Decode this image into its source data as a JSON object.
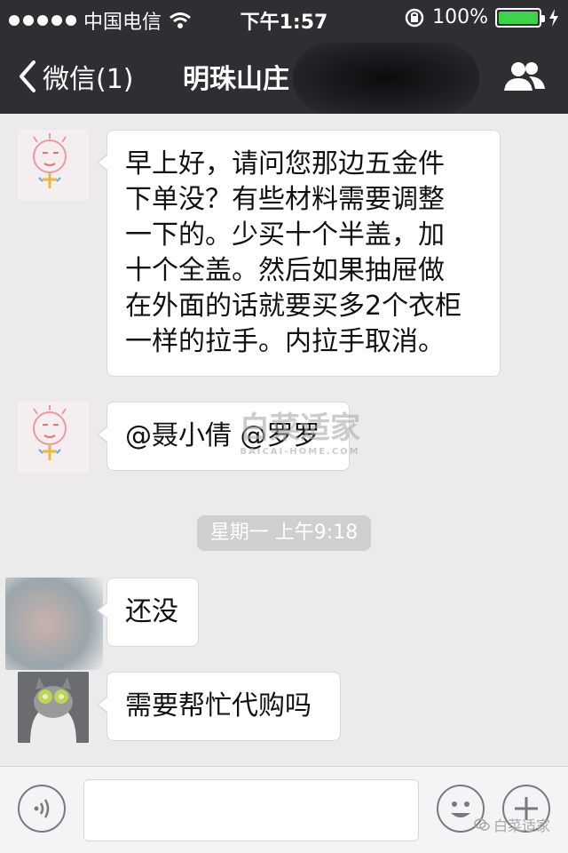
{
  "status_bar": {
    "carrier": "中国电信",
    "time": "下午1:57",
    "battery_percent": "100%",
    "battery_level": 1.0,
    "icons": [
      "signal-dots-icon",
      "wifi-icon",
      "rotation-lock-icon",
      "battery-icon",
      "charging-icon"
    ]
  },
  "nav_bar": {
    "back_label": "微信(1)",
    "title": "明珠山庄",
    "icons": [
      "back-chevron-icon",
      "contacts-icon"
    ]
  },
  "messages": [
    {
      "sender": "left",
      "avatar": "drawing-avatar",
      "text_lines": [
        "早上好，请问您那边五金件",
        "下单没？有些材料需要调整",
        "一下的。少买十个半盖，加",
        "十个全盖。然后如果抽屉做",
        "在外面的话就要买多2个衣柜",
        "一样的拉手。内拉手取消。"
      ]
    },
    {
      "sender": "left",
      "avatar": "drawing-avatar",
      "text_lines": [
        "@聂小倩 @罗罗"
      ]
    },
    {
      "sender": "left",
      "avatar": "blurred-avatar",
      "text_lines": [
        "还没"
      ]
    },
    {
      "sender": "left",
      "avatar": "cat-avatar",
      "text_lines": [
        "需要帮忙代购吗"
      ]
    }
  ],
  "timestamp_pill": "星期一 上午9:18",
  "watermark": {
    "text": "白菜适家",
    "subtext": "BAICAI-HOME.COM"
  },
  "input_bar": {
    "icons": [
      "voice-icon",
      "emoji-icon",
      "plus-icon"
    ]
  },
  "branding": "白菜适家",
  "colors": {
    "bar_bg": "#2e2e33",
    "chat_bg": "#ebebeb",
    "bubble_bg": "#ffffff",
    "battery_green": "#3ed34d",
    "time_pill_bg": "#cfcfcf"
  }
}
